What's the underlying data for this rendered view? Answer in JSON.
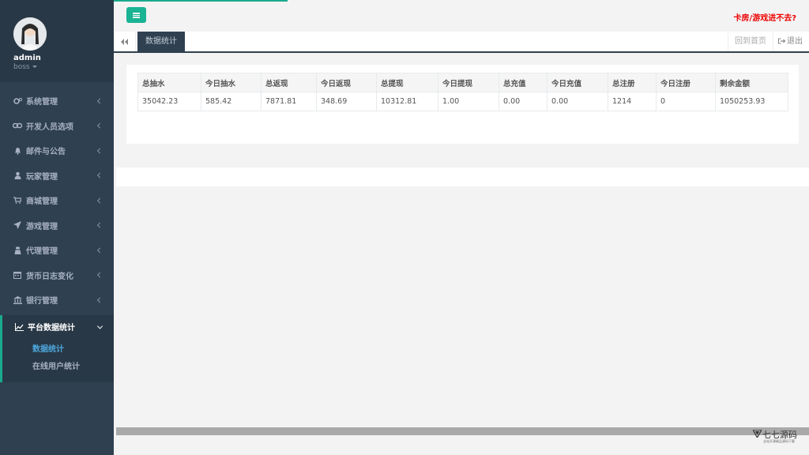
{
  "user": {
    "name": "admin",
    "role": "boss"
  },
  "sidebar": {
    "items": [
      {
        "label": "系统管理",
        "icon": "cogs-icon"
      },
      {
        "label": "开发人员选项",
        "icon": "link-icon"
      },
      {
        "label": "邮件与公告",
        "icon": "bell-icon"
      },
      {
        "label": "玩家管理",
        "icon": "user-icon"
      },
      {
        "label": "商城管理",
        "icon": "cart-icon"
      },
      {
        "label": "游戏管理",
        "icon": "rocket-icon"
      },
      {
        "label": "代理管理",
        "icon": "agent-icon"
      },
      {
        "label": "货币日志变化",
        "icon": "calendar-icon"
      },
      {
        "label": "银行管理",
        "icon": "bank-icon"
      }
    ],
    "active": {
      "label": "平台数据统计",
      "icon": "chart-line-icon"
    },
    "subitems": [
      {
        "label": "数据统计"
      },
      {
        "label": "在线用户统计"
      }
    ]
  },
  "topbar": {
    "notice": "卡房/游戏进不去?"
  },
  "tabs": {
    "active": "数据统计",
    "home": "回到首页",
    "logout": "退出"
  },
  "stats": {
    "headers": [
      "总抽水",
      "今日抽水",
      "总返现",
      "今日返现",
      "总提现",
      "今日提现",
      "总充值",
      "今日充值",
      "总注册",
      "今日注册",
      "剩余金额"
    ],
    "rows": [
      [
        "35042.23",
        "585.42",
        "7871.81",
        "348.69",
        "10312.81",
        "1.00",
        "0.00",
        "0.00",
        "1214",
        "0",
        "1050253.93"
      ]
    ]
  },
  "watermark": {
    "title": "七七源码",
    "subtitle": "全站开源精品源码下载"
  },
  "colors": {
    "sidebar": "#2f4050",
    "accent": "#1ab394",
    "notice": "#ed0000",
    "active_sub": "#4da7dd"
  }
}
